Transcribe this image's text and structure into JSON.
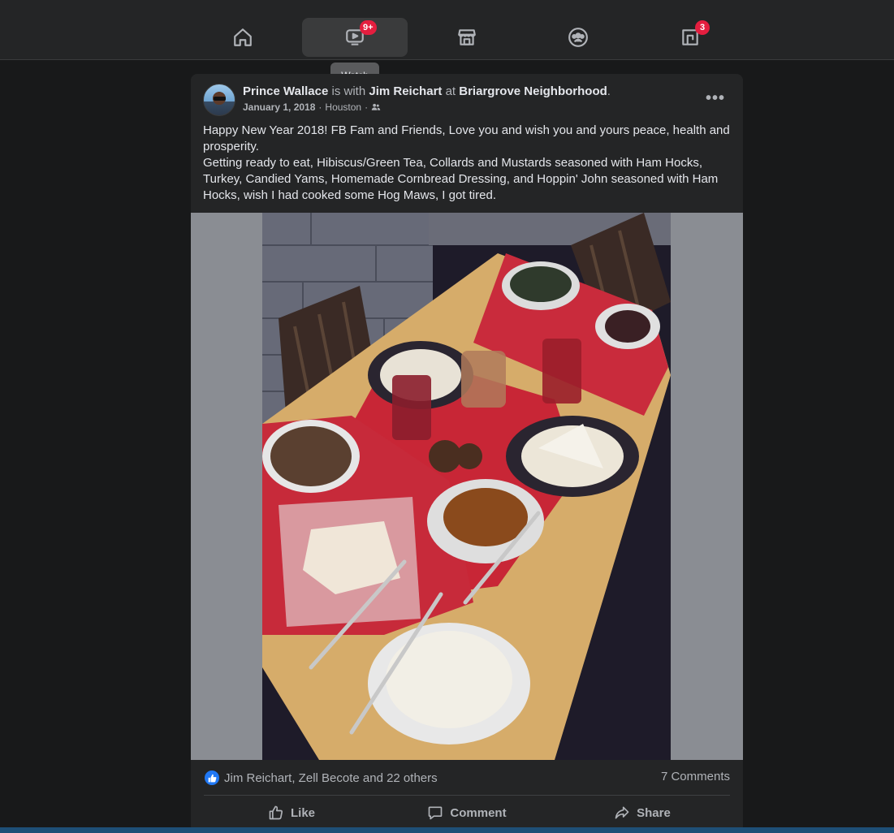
{
  "colors": {
    "background": "#18191a",
    "surface": "#242526",
    "accent": "#2078f4",
    "badge": "#e41e3f"
  },
  "nav": {
    "tabs": [
      {
        "name": "Home",
        "icon": "home-icon"
      },
      {
        "name": "Watch",
        "icon": "watch-icon",
        "badge": "9+"
      },
      {
        "name": "Marketplace",
        "icon": "marketplace-icon"
      },
      {
        "name": "Groups",
        "icon": "groups-icon"
      },
      {
        "name": "Gaming",
        "icon": "gaming-icon",
        "badge": "3"
      }
    ],
    "tooltip": "Watch"
  },
  "post": {
    "author": "Prince Wallace",
    "with_text": " is with ",
    "tagged": "Jim Reichart",
    "at_text": " at ",
    "location": "Briargrove Neighborhood",
    "period": ".",
    "date": "January 1, 2018",
    "place": "Houston",
    "separator": "·",
    "audience_icon": "friends-icon",
    "more_label": "•••",
    "text_line1": "Happy New Year 2018! FB Fam and Friends, Love you and wish you and yours peace, health and prosperity.",
    "text_line2": "Getting ready to eat, Hibiscus/Green Tea, Collards and Mustards seasoned with Ham Hocks, Turkey, Candied Yams, Homemade Cornbread Dressing, and Hoppin' John seasoned with Ham Hocks, wish I had cooked some Hog Maws, I got tired.",
    "photo_icon": "dinner-table-photo"
  },
  "footer": {
    "reactions_text": "Jim Reichart, Zell Becote and 22 others",
    "comments_text": "7 Comments",
    "like_label": "Like",
    "comment_label": "Comment",
    "share_label": "Share"
  }
}
